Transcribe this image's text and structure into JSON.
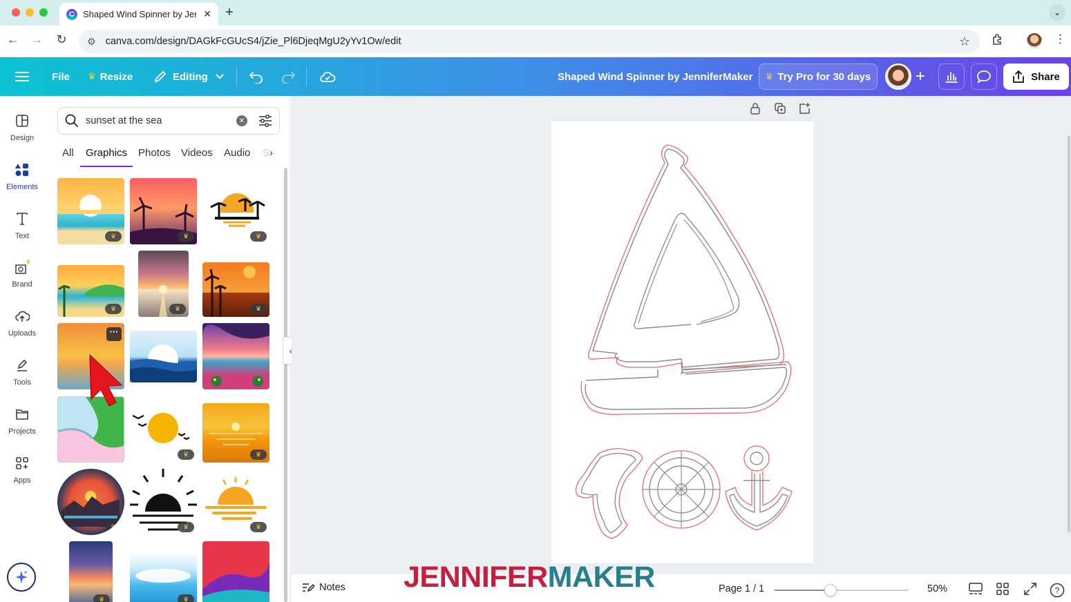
{
  "browser": {
    "tab_title": "Shaped Wind Spinner by Jen",
    "url": "canva.com/design/DAGkFcGUcS4/jZie_Pl6DjeqMgU2yYv1Ow/edit"
  },
  "editor": {
    "file_label": "File",
    "resize_label": "Resize",
    "editing_label": "Editing",
    "doc_title": "Shaped Wind Spinner by JenniferMaker",
    "try_pro_label": "Try Pro for 30 days",
    "share_label": "Share"
  },
  "rail": {
    "items": [
      {
        "label": "Design",
        "icon": "layout-icon"
      },
      {
        "label": "Elements",
        "icon": "shapes-icon"
      },
      {
        "label": "Text",
        "icon": "text-icon"
      },
      {
        "label": "Brand",
        "icon": "brand-icon"
      },
      {
        "label": "Uploads",
        "icon": "cloud-upload-icon"
      },
      {
        "label": "Tools",
        "icon": "pen-tool-icon"
      },
      {
        "label": "Projects",
        "icon": "folder-icon"
      },
      {
        "label": "Apps",
        "icon": "apps-icon"
      }
    ]
  },
  "panel": {
    "search_value": "sunset at the sea",
    "tabs": [
      "All",
      "Graphics",
      "Photos",
      "Videos",
      "Audio",
      "S"
    ],
    "active_tab": "Graphics"
  },
  "footer": {
    "notes_label": "Notes",
    "brand_part1": "JENNIFER",
    "brand_part2": "MAKER",
    "page_indicator": "Page 1 / 1",
    "zoom": "50%",
    "zoom_fraction": 0.42,
    "help": "?"
  },
  "colors": {
    "accent": "#7d2ae8",
    "brand_red": "#c61e3d",
    "brand_teal": "#26808c",
    "cut_line_red": "#e46a6a",
    "cut_line_gray": "#8a8f95"
  }
}
